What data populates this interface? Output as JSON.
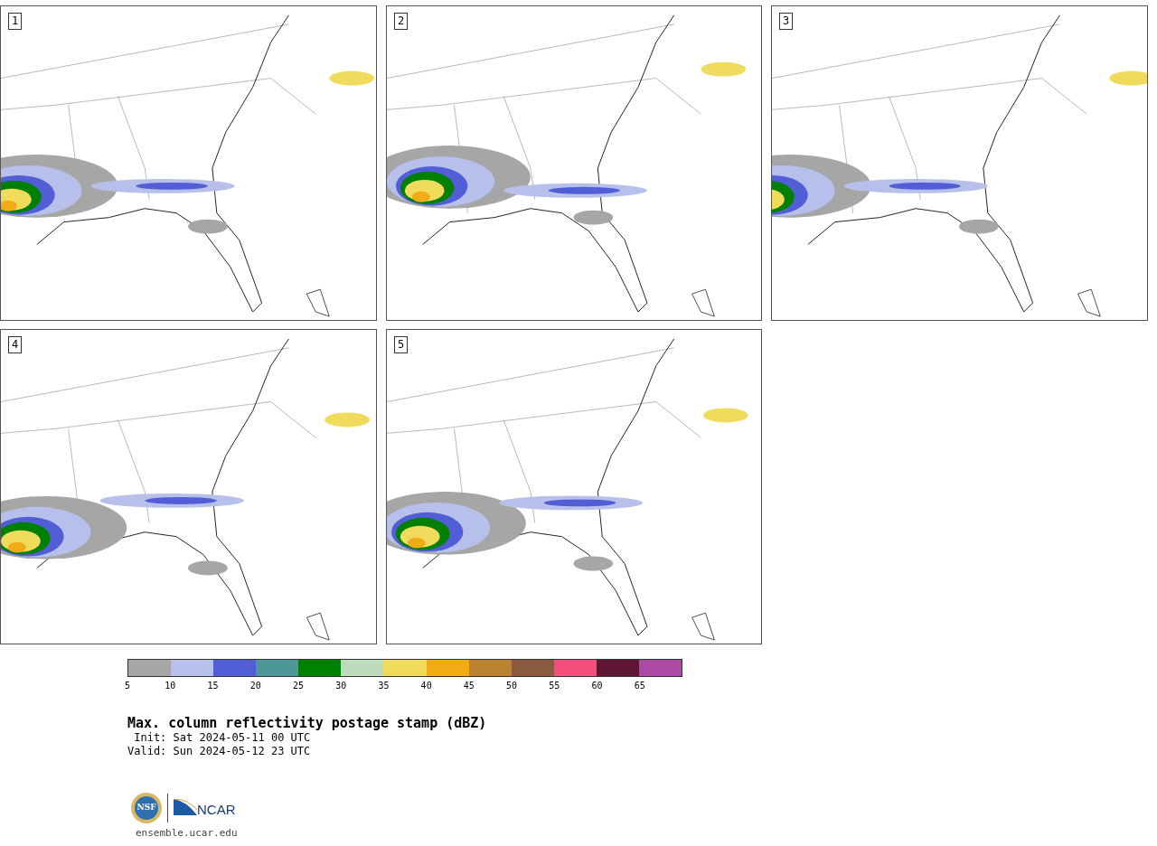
{
  "panels": [
    {
      "label": "1"
    },
    {
      "label": "2"
    },
    {
      "label": "3"
    },
    {
      "label": "4"
    },
    {
      "label": "5"
    }
  ],
  "colorbar": [
    {
      "label": "5",
      "color": "#a6a6a6"
    },
    {
      "label": "10",
      "color": "#b7c0ea"
    },
    {
      "label": "15",
      "color": "#525ed6"
    },
    {
      "label": "20",
      "color": "#4d9699"
    },
    {
      "label": "25",
      "color": "#008000"
    },
    {
      "label": "30",
      "color": "#bcdcbc"
    },
    {
      "label": "35",
      "color": "#f1db5c"
    },
    {
      "label": "40",
      "color": "#f0ab17"
    },
    {
      "label": "45",
      "color": "#bb8230"
    },
    {
      "label": "50",
      "color": "#8b5a3e"
    },
    {
      "label": "55",
      "color": "#f44f7c"
    },
    {
      "label": "60",
      "color": "#5f1634"
    },
    {
      "label": "65",
      "color": "#ac4aa5"
    }
  ],
  "title": "Max. column reflectivity postage stamp (dBZ)",
  "init": " Init: Sat 2024-05-11 00 UTC",
  "valid": "Valid: Sun 2024-05-12 23 UTC",
  "logo": {
    "nsf": "NSF",
    "ncar": "NCAR"
  },
  "site": "ensemble.ucar.edu"
}
